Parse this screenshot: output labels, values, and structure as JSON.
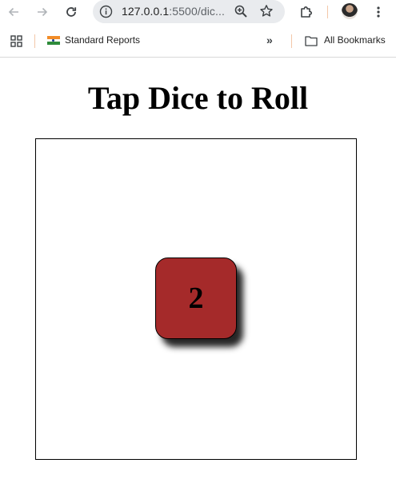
{
  "browser": {
    "url_host": "127.0.0.1",
    "url_rest": ":5500/dic...",
    "icons": {
      "back": "arrow-left-icon",
      "forward": "arrow-right-icon",
      "reload": "reload-icon",
      "site_info": "info-icon",
      "zoom": "zoom-icon",
      "bookmark_star": "star-icon",
      "extensions": "puzzle-icon",
      "menu": "kebab-menu-icon"
    }
  },
  "bookmarks": {
    "items": [
      {
        "label": "Standard Reports",
        "icon": "india-flag-icon"
      }
    ],
    "overflow_label": "»",
    "all_bookmarks_label": "All Bookmarks"
  },
  "page": {
    "title": "Tap Dice to Roll",
    "die": {
      "value": "2",
      "color": "#a52a2a"
    }
  }
}
